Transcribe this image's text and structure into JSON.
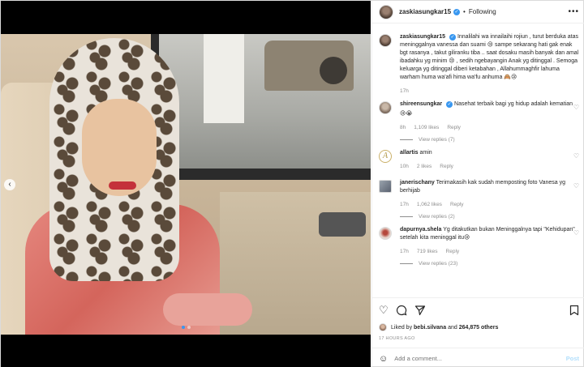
{
  "header": {
    "username": "zaskiasungkar15",
    "separator": "•",
    "follow_status": "Following",
    "more": "•••"
  },
  "caption": {
    "username": "zaskiasungkar15",
    "text": "Innalilahi wa innailaihi rojiun , turut berduka atas meninggalnya vanessa dan suami 😢 sampe sekarang hati gak enak bgt rasanya , takut giliranku tiba .. saat dosaku masih banyak dan amal ibadahku yg minim 😢 , sedih ngebayangin Anak yg ditinggal . Semoga keluarga yg ditinggal diberi ketabahan , Allahummaghfir lahuma warham huma wa'afi hima wa'fu anhuma 🙈😢",
    "time": "17h"
  },
  "comments": [
    {
      "username": "shireensungkar",
      "text": "Nasehat terbaik bagi yg hidup adalah kematian",
      "emoji": "😢😭",
      "time": "8h",
      "likes": "1,109 likes",
      "reply": "Reply",
      "view_replies": "View replies (7)"
    },
    {
      "username": "allartis",
      "text": "amin",
      "time": "10h",
      "likes": "2 likes",
      "reply": "Reply",
      "avatar_letter": "A"
    },
    {
      "username": "janerischany",
      "text": "Terimakasih kak sudah memposting foto Vanesa yg berhijab",
      "time": "17h",
      "likes": "1,062 likes",
      "reply": "Reply",
      "view_replies": "View replies (2)"
    },
    {
      "username": "dapurnya.shela",
      "text": "Yg ditakutkan bukan Meninggalnya tapi \"Kehidupan\" setelah kita meninggal itu😢",
      "time": "17h",
      "likes": "719 likes",
      "reply": "Reply",
      "view_replies": "View replies (23)"
    }
  ],
  "actions": {
    "like_icon": "heart-outline-icon",
    "comment_icon": "comment-icon",
    "share_icon": "share-icon",
    "save_icon": "bookmark-icon"
  },
  "likes": {
    "prefix": "Liked by",
    "user": "bebi.silvana",
    "and": "and",
    "others": "264,875 others"
  },
  "time_ago": "17 HOURS AGO",
  "add_comment": {
    "placeholder": "Add a comment...",
    "post_label": "Post"
  },
  "colors": {
    "accent": "#3897f0",
    "muted": "#8e8e8e",
    "post_disabled": "#b2dffc"
  }
}
